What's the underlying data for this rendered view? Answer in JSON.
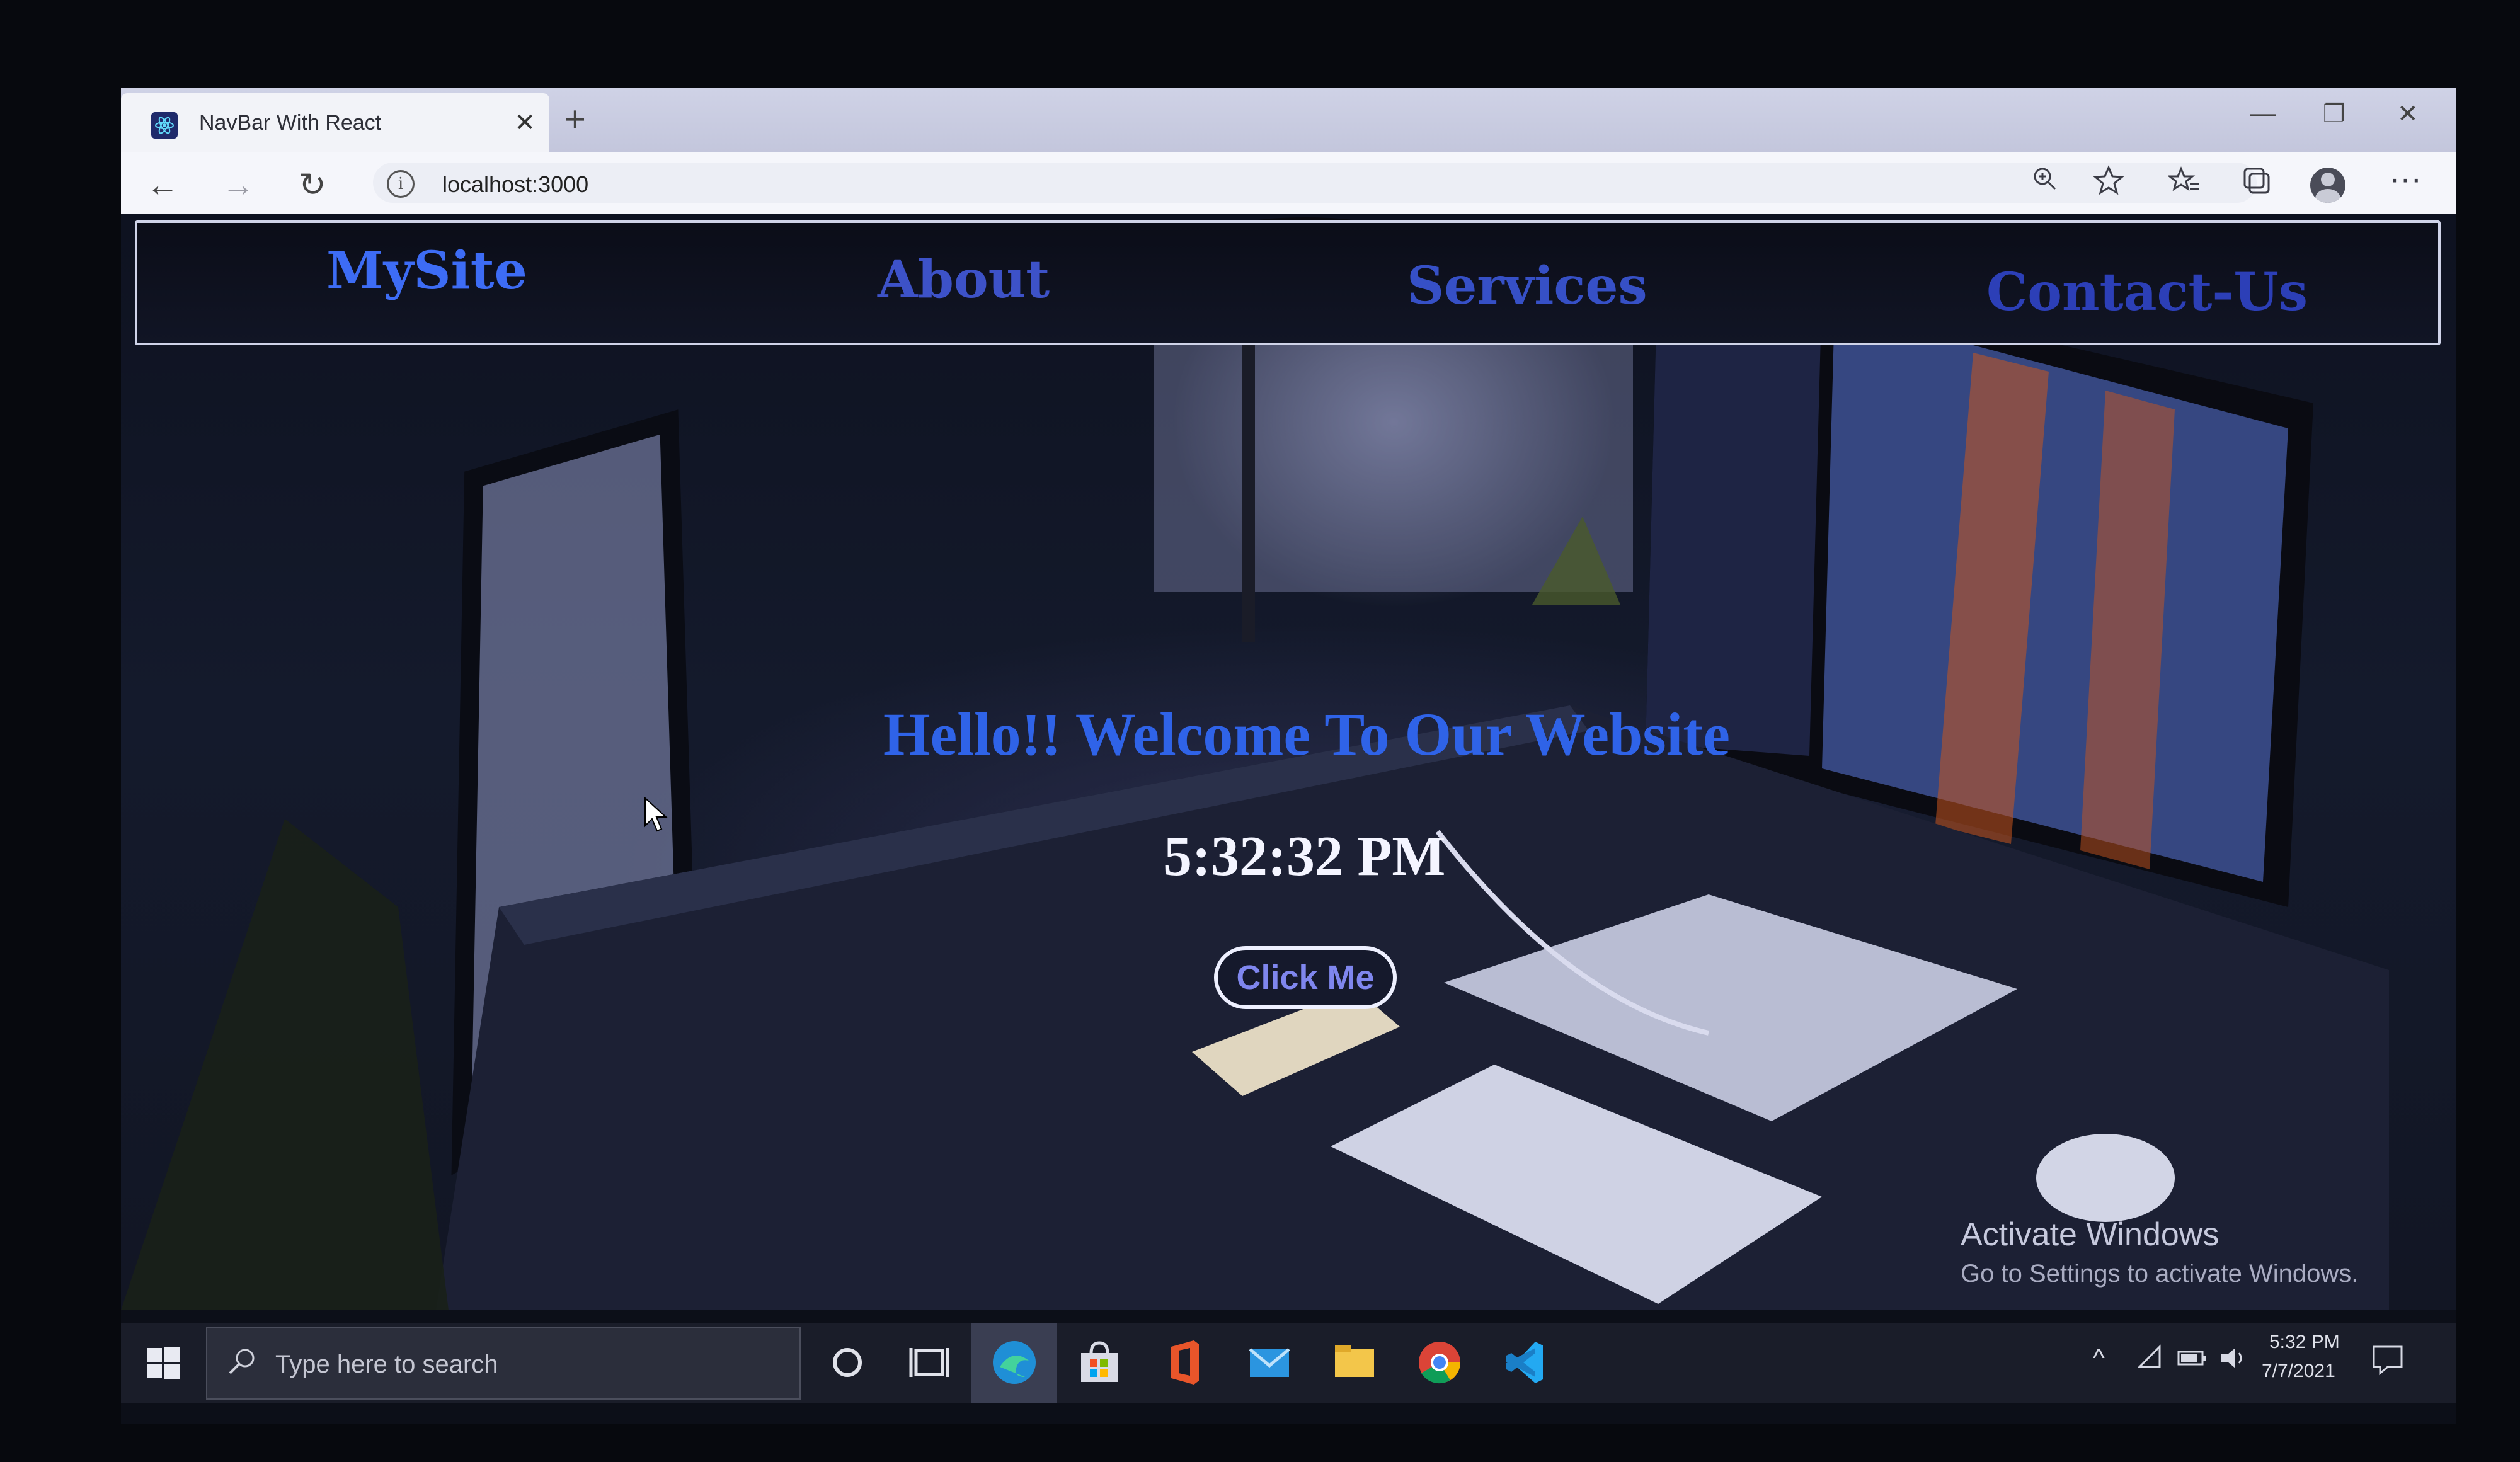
{
  "browser": {
    "tab_title": "NavBar With React",
    "tab_close": "✕",
    "new_tab": "+",
    "address": "localhost:3000",
    "window_controls": {
      "minimize": "—",
      "restore": "❐",
      "close": "✕"
    },
    "nav": {
      "back": "←",
      "forward": "→",
      "reload": "↻"
    },
    "toolbar_icons": [
      "zoom-icon",
      "add-favorite-icon",
      "favorites-icon",
      "collections-icon",
      "profile-icon",
      "more-icon"
    ],
    "more_label": "···"
  },
  "navbar": {
    "brand": "MySite",
    "links": [
      "About",
      "Services",
      "Contact-Us"
    ]
  },
  "hero": {
    "title": "Hello!! Welcome To Our Website",
    "clock": "5:32:32 PM",
    "button": "Click Me"
  },
  "watermark": {
    "title": "Activate Windows",
    "subtitle": "Go to Settings to activate Windows."
  },
  "taskbar": {
    "search_placeholder": "Type here to search",
    "apps": [
      "cortana-icon",
      "task-view-icon",
      "edge-icon",
      "store-icon",
      "office-icon",
      "mail-icon",
      "file-explorer-icon",
      "chrome-icon",
      "vscode-icon"
    ],
    "time": "5:32 PM",
    "date": "7/7/2021"
  },
  "colors": {
    "brand": "#3d6cf5",
    "nav_link": "#3650c6",
    "hero_title": "#2f63e8",
    "button_text": "#7f86ee"
  }
}
